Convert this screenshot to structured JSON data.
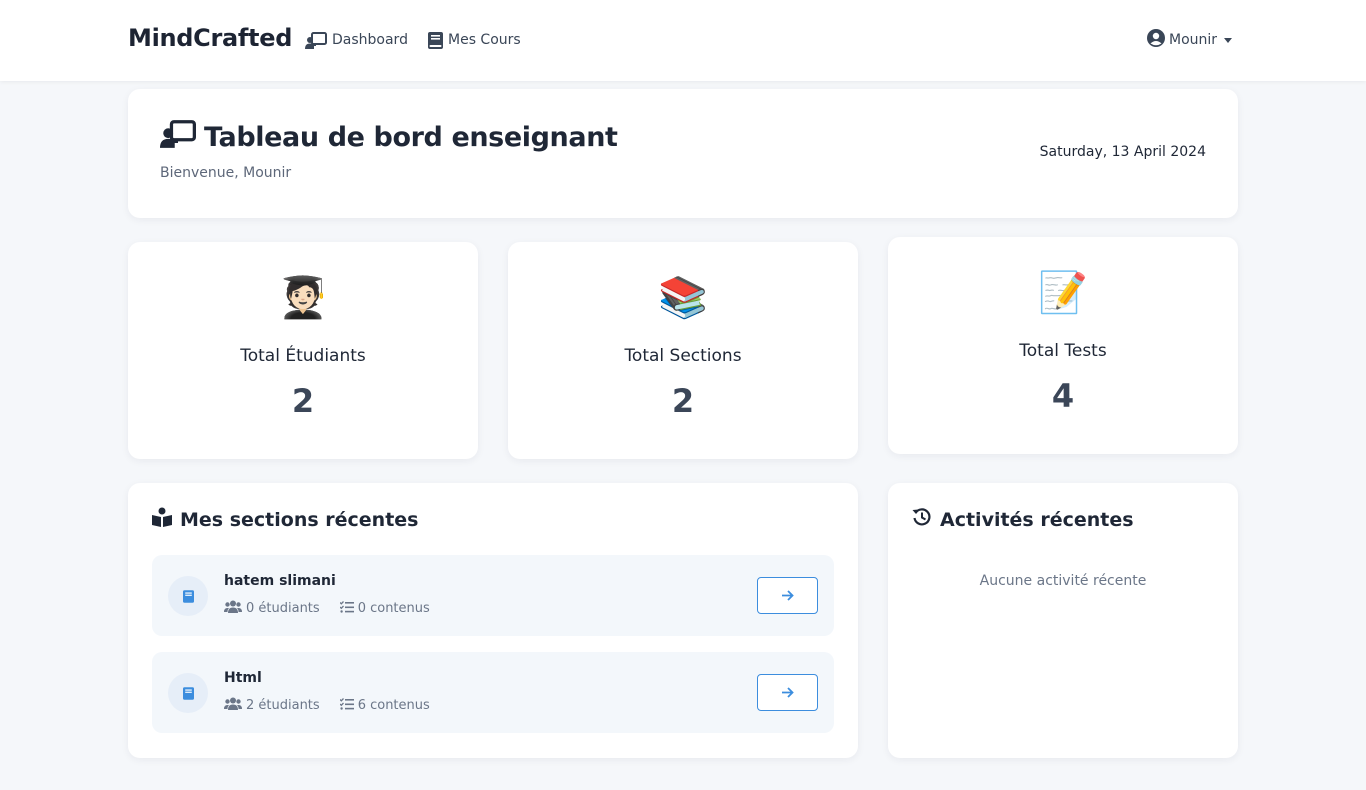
{
  "navbar": {
    "brand": "MindCrafted",
    "links": [
      {
        "label": "Dashboard",
        "icon": "teacher-board-icon"
      },
      {
        "label": "Mes Cours",
        "icon": "book-icon"
      }
    ],
    "user": {
      "name": "Mounir",
      "icon": "user-circle-icon"
    }
  },
  "header": {
    "title": "Tableau de bord enseignant",
    "welcome": "Bienvenue, Mounir",
    "date": "Saturday, 13 April 2024"
  },
  "stats": [
    {
      "emoji": "🧑🏻‍🎓",
      "label": "Total Étudiants",
      "value": "2"
    },
    {
      "emoji": "📚",
      "label": "Total Sections",
      "value": "2"
    },
    {
      "emoji": "📝",
      "label": "Total Tests",
      "value": "4"
    }
  ],
  "sections": {
    "heading": "Mes sections récentes",
    "items": [
      {
        "name": "hatem slimani",
        "students": "0 étudiants",
        "contents": "0 contenus"
      },
      {
        "name": "Html",
        "students": "2 étudiants",
        "contents": "6 contenus"
      }
    ]
  },
  "activity": {
    "heading": "Activités récentes",
    "empty": "Aucune activité récente"
  },
  "colors": {
    "accent": "#3c8dde",
    "background": "#f5f7fa",
    "section_bg": "#f3f7fb"
  }
}
